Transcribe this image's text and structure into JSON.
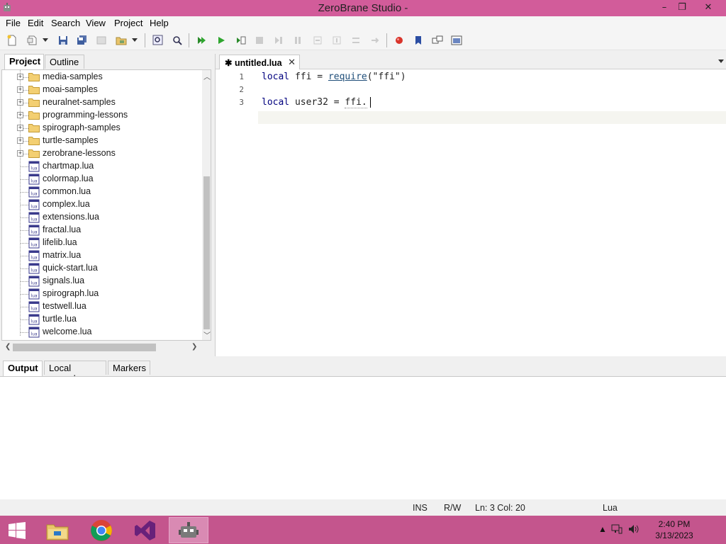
{
  "window": {
    "title": "ZeroBrane Studio -",
    "buttons": {
      "minimize": "–",
      "restore": "❐",
      "close": "✕"
    }
  },
  "menu": [
    "File",
    "Edit",
    "Search",
    "View",
    "Project",
    "Help"
  ],
  "left_panel": {
    "tabs": [
      "Project",
      "Outline"
    ],
    "active_tab": "Project",
    "folders": [
      "media-samples",
      "moai-samples",
      "neuralnet-samples",
      "programming-lessons",
      "spirograph-samples",
      "turtle-samples",
      "zerobrane-lessons"
    ],
    "files": [
      "chartmap.lua",
      "colormap.lua",
      "common.lua",
      "complex.lua",
      "extensions.lua",
      "fractal.lua",
      "lifelib.lua",
      "matrix.lua",
      "quick-start.lua",
      "signals.lua",
      "spirograph.lua",
      "testwell.lua",
      "turtle.lua",
      "welcome.lua"
    ]
  },
  "editor": {
    "tab_label": "untitled.lua",
    "tab_modified_marker": "✱",
    "lines": [
      {
        "num": "1",
        "kw": "local",
        "rest_a": " ffi = ",
        "fn": "require",
        "rest_b": "(\"ffi\")"
      },
      {
        "num": "2",
        "kw": "",
        "rest_a": "",
        "fn": "",
        "rest_b": ""
      },
      {
        "num": "3",
        "kw": "local",
        "rest_a": " user32 = ",
        "fn": "",
        "rest_b": "ffi."
      }
    ]
  },
  "bottom_panel": {
    "tabs": [
      "Output",
      "Local console",
      "Markers"
    ],
    "active_tab": "Output"
  },
  "status": {
    "mode": "INS",
    "access": "R/W",
    "position": "Ln: 3 Col: 20",
    "language": "Lua"
  },
  "taskbar": {
    "apps": [
      "windows-start",
      "file-explorer",
      "chrome",
      "visual-studio",
      "zerobrane-studio"
    ],
    "active_app": "zerobrane-studio",
    "time": "2:40 PM",
    "date": "3/13/2023"
  },
  "colors": {
    "titlebar": "#d25c9a",
    "taskbar": "#c4558d",
    "keyword": "#00007f"
  }
}
